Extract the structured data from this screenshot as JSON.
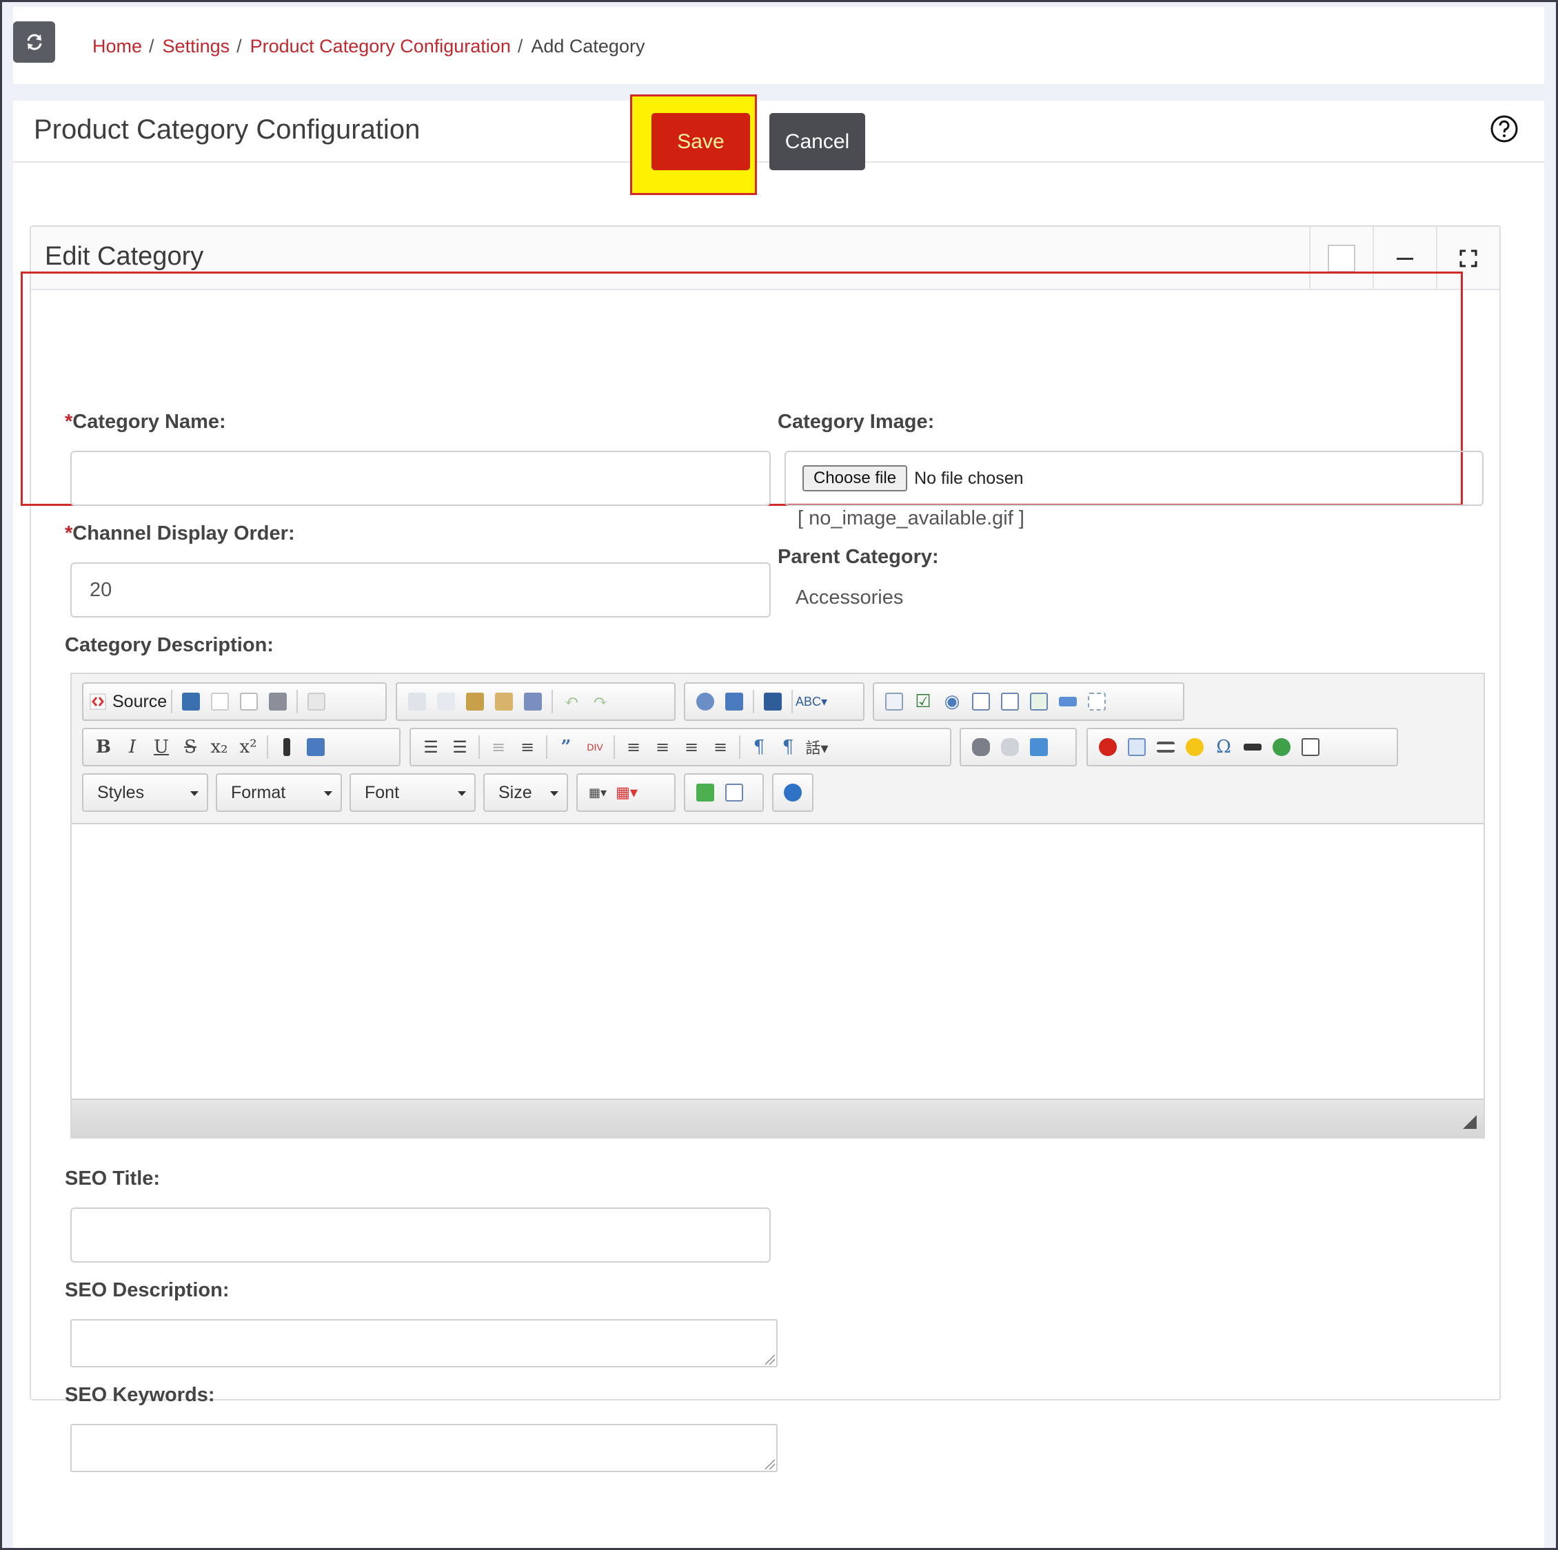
{
  "breadcrumb": {
    "home": "Home",
    "settings": "Settings",
    "config": "Product Category Configuration",
    "current": "Add Category",
    "separator": "/"
  },
  "page": {
    "title": "Product Category Configuration"
  },
  "actions": {
    "save": "Save",
    "cancel": "Cancel"
  },
  "card": {
    "title": "Edit Category"
  },
  "form": {
    "category_name_label": "Category Name:",
    "category_name_value": "",
    "display_order_label": "Channel Display Order:",
    "display_order_value": "20",
    "category_image_label": "Category Image:",
    "choose_file_label": "Choose file",
    "no_file_text": "No file chosen",
    "current_image": "[ no_image_available.gif ]",
    "parent_category_label": "Parent Category:",
    "parent_category_value": "Accessories",
    "required_mark": "*",
    "description_label": "Category Description:",
    "seo_title_label": "SEO Title:",
    "seo_description_label": "SEO Description:",
    "seo_keywords_label": "SEO Keywords:"
  },
  "editor": {
    "source_label": "Source",
    "styles_label": "Styles",
    "format_label": "Format",
    "font_label": "Font",
    "size_label": "Size",
    "bold": "B",
    "italic": "I",
    "underline": "U",
    "strike": "S"
  },
  "colors": {
    "accent": "#c0282d",
    "save_bg": "#d02010",
    "highlight": "#fff200"
  }
}
